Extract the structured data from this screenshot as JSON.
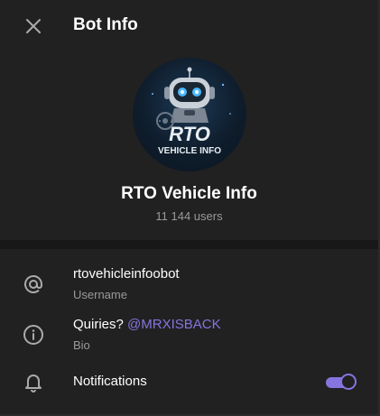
{
  "header": {
    "title": "Bot Info"
  },
  "profile": {
    "name": "RTO Vehicle Info",
    "members": "11 144 users",
    "avatar_line1": "RTO",
    "avatar_line2": "VEHICLE INFO"
  },
  "info": {
    "username": {
      "value": "rtovehicleinfoobot",
      "label": "Username",
      "icon": "at-icon"
    },
    "bio": {
      "prefix": "Quiries? ",
      "mention": "@MRXISBACK",
      "label": "Bio",
      "icon": "info-icon"
    },
    "notifications": {
      "label": "Notifications",
      "enabled": true,
      "icon": "bell-icon"
    }
  },
  "colors": {
    "accent": "#8774e1",
    "background": "#212121",
    "secondary_text": "#9a9a9a"
  }
}
